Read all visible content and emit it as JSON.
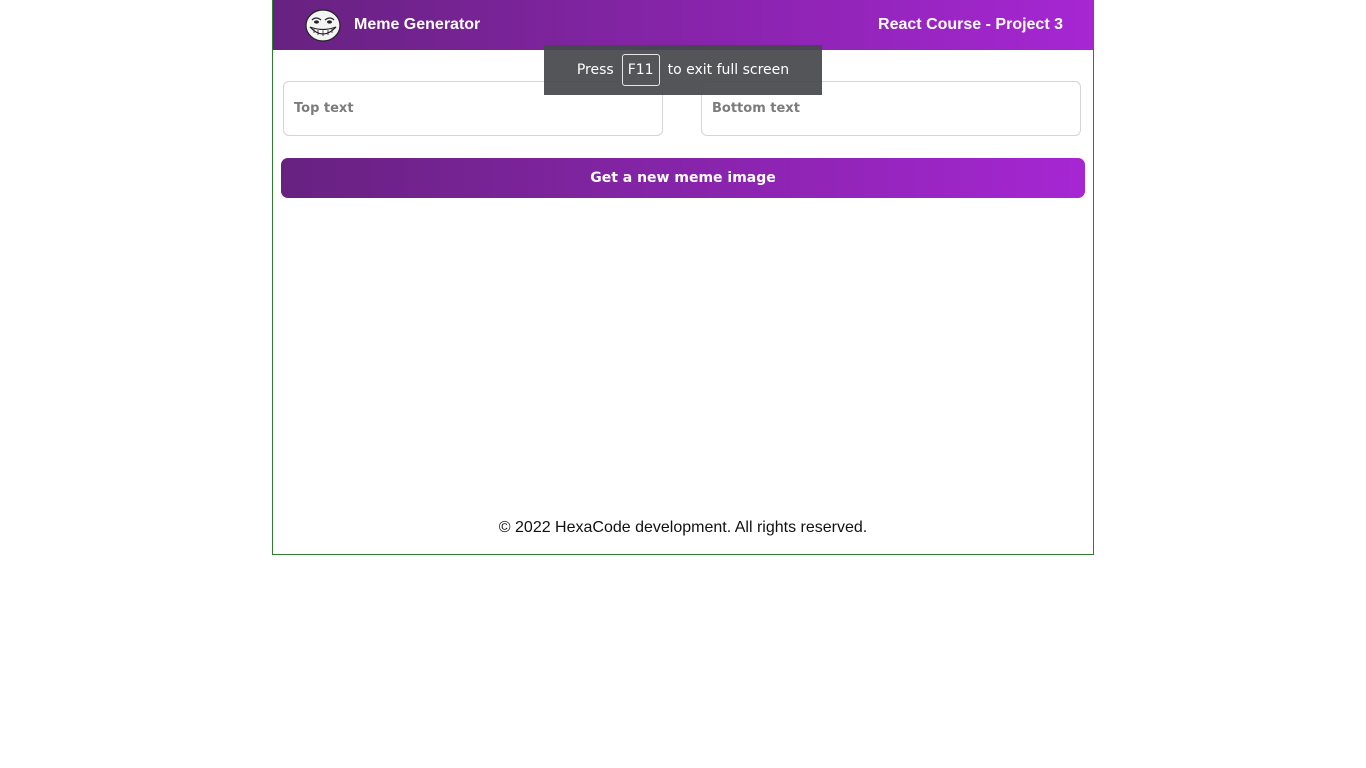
{
  "header": {
    "logo_icon": "troll-face-icon",
    "brand": "Meme Generator",
    "project": "React Course - Project 3"
  },
  "form": {
    "top_placeholder": "Top text",
    "bottom_placeholder": "Bottom text",
    "top_value": "",
    "bottom_value": "",
    "submit_label": "Get a new meme image"
  },
  "footer": {
    "text": "© 2022 HexaCode development. All rights reserved."
  },
  "fullscreen_notice": {
    "before": "Press",
    "key": "F11",
    "after": "to exit full screen"
  },
  "colors": {
    "gradient_start": "#672280",
    "gradient_end": "#a626d3",
    "frame_border": "#2f7d2f"
  }
}
